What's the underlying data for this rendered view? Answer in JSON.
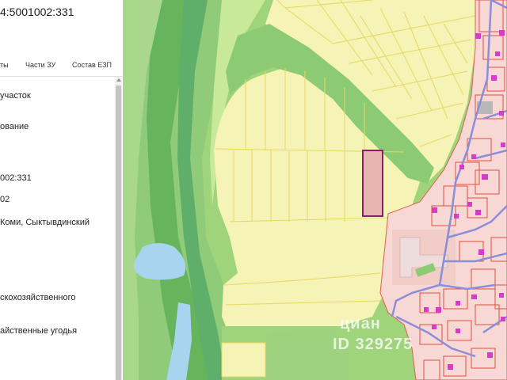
{
  "panel": {
    "cadastral_number": "4:5001002:331",
    "tabs": [
      "ты",
      "Части ЗУ",
      "Состав ЕЗП"
    ],
    "fields": [
      "участок",
      "ование",
      "002:331",
      "02",
      "Коми, Сыктывдинский",
      "скохозяйственного",
      "айственные угодья"
    ]
  },
  "watermark": {
    "brand": "циан",
    "listing_id": "ID 329275"
  },
  "colors": {
    "forest": "#8dc86a",
    "meadow": "#cde8a4",
    "farmland": "#f5f3b5",
    "parcel_line": "#e6d860",
    "selected_parcel_fill": "#e8b4b0",
    "selected_parcel_border": "#8a1e6e",
    "buildings_zone": "#f8d8d4",
    "building_magenta": "#d63cc8",
    "road_blue": "#8a8ed8",
    "water": "#a8d4f0"
  }
}
